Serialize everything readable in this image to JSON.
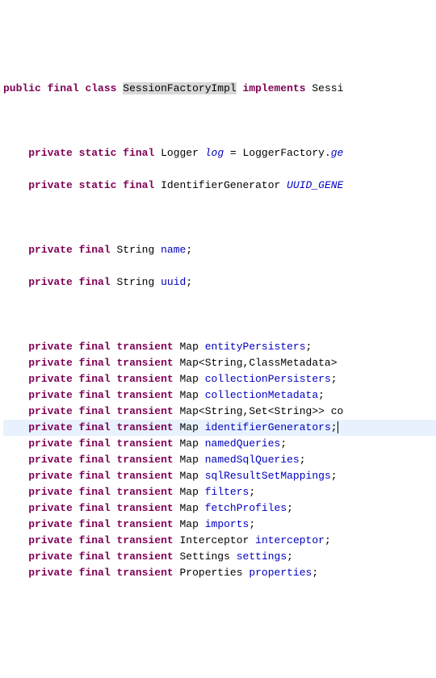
{
  "code": {
    "class_decl": {
      "public": "public",
      "final": "final",
      "class_kw": "class",
      "class_name": "SessionFactoryImpl",
      "implements_kw": "implements",
      "implements_type": "Sessi"
    },
    "logger_line": {
      "private": "private",
      "static": "static",
      "final": "final",
      "type": "Logger",
      "name": "log",
      "eq": " = ",
      "factory": "LoggerFactory.",
      "method": "ge"
    },
    "uuid_gen_line": {
      "private": "private",
      "static": "static",
      "final": "final",
      "type": "IdentifierGenerator",
      "name": "UUID_GENE"
    },
    "name_field": {
      "private": "private",
      "final": "final",
      "type": "String",
      "name": "name",
      "semi": ";"
    },
    "uuid_field": {
      "private": "private",
      "final": "final",
      "type": "String",
      "name": "uuid",
      "semi": ";"
    },
    "fields": [
      {
        "type": "Map",
        "generic": "",
        "name": "entityPersisters",
        "semi": ";"
      },
      {
        "type": "Map",
        "generic": "<String,ClassMetadata>",
        "name": "",
        "semi": ""
      },
      {
        "type": "Map",
        "generic": "",
        "name": "collectionPersisters",
        "semi": ";"
      },
      {
        "type": "Map",
        "generic": "",
        "name": "collectionMetadata",
        "semi": ";"
      },
      {
        "type": "Map",
        "generic": "<String,Set<String>>",
        "name": "",
        "semi": " co",
        "tail": true
      },
      {
        "type": "Map",
        "generic": "",
        "name": "identifierGenerators",
        "semi": ";",
        "highlight": true,
        "cursor": true
      },
      {
        "type": "Map",
        "generic": "",
        "name": "namedQueries",
        "semi": ";"
      },
      {
        "type": "Map",
        "generic": "",
        "name": "namedSqlQueries",
        "semi": ";"
      },
      {
        "type": "Map",
        "generic": "",
        "name": "sqlResultSetMappings",
        "semi": ";"
      },
      {
        "type": "Map",
        "generic": "",
        "name": "filters",
        "semi": ";"
      },
      {
        "type": "Map",
        "generic": "",
        "name": "fetchProfiles",
        "semi": ";"
      },
      {
        "type": "Map",
        "generic": "",
        "name": "imports",
        "semi": ";"
      },
      {
        "type": "Interceptor",
        "generic": "",
        "name": "interceptor",
        "semi": ";"
      },
      {
        "type": "Settings",
        "generic": "",
        "name": "settings",
        "semi": ";"
      },
      {
        "type": "Properties",
        "generic": "",
        "name": "properties",
        "semi": ";"
      }
    ],
    "kw": {
      "private": "private",
      "final": "final",
      "transient": "transient"
    }
  }
}
